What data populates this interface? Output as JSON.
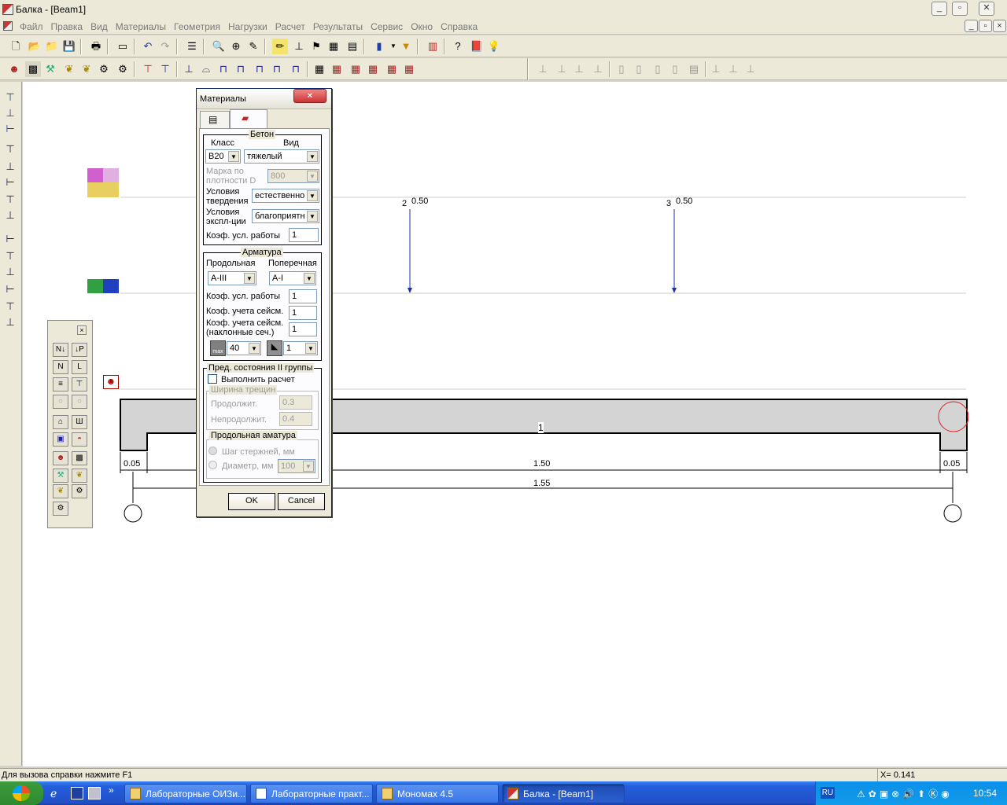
{
  "window": {
    "title": "Балка - [Beam1]"
  },
  "menu": [
    "Файл",
    "Правка",
    "Вид",
    "Материалы",
    "Геометрия",
    "Нагрузки",
    "Расчет",
    "Результаты",
    "Сервис",
    "Окно",
    "Справка"
  ],
  "dialog": {
    "title": "Материалы",
    "concrete": {
      "legend": "Бетон",
      "class_label": "Класс",
      "type_label": "Вид",
      "class_value": "В20",
      "type_value": "тяжелый",
      "density_label": "Марка по плотности D",
      "density_value": "800",
      "hardening_label": "Условия твердения",
      "hardening_value": "естественно",
      "operation_label": "Условия экспл-ции",
      "operation_value": "благоприятн",
      "work_coef_label": "Коэф. усл. работы",
      "work_coef_value": "1"
    },
    "rebar": {
      "legend": "Арматура",
      "long_label": "Продольная",
      "trans_label": "Поперечная",
      "long_value": "A-III",
      "trans_value": "A-I",
      "work_coef_label": "Коэф. усл. работы",
      "work_coef_value": "1",
      "seismic_label": "Коэф. учета сейсм.",
      "seismic_value": "1",
      "seismic_incl_label": "Коэф. учета сейсм. (наклонные сеч.)",
      "seismic_incl_value": "1",
      "max_diam_icon_text": "max",
      "max_diam_value": "40",
      "extra_value": "1"
    },
    "limit2": {
      "legend": "Пред. состояния II группы",
      "do_calc_label": "Выполнить расчет",
      "crack_legend": "Ширина трещин",
      "long_label": "Продолжит.",
      "long_value": "0.3",
      "short_label": "Непродолжит.",
      "short_value": "0.4",
      "long_rebar_legend": "Продольная аматура",
      "step_label": "Шаг стержней, мм",
      "diam_label": "Диаметр, мм",
      "diam_value": "100"
    },
    "ok": "OK",
    "cancel": "Cancel"
  },
  "drawing": {
    "loads": [
      {
        "node": "2",
        "value": "0.50"
      },
      {
        "node": "3",
        "value": "0.50"
      }
    ],
    "element_label": "1",
    "dim_left": "0.05",
    "dim_span": "1.50",
    "dim_right": "0.05",
    "dim_total": "1.55"
  },
  "status": {
    "hint": "Для вызова справки нажмите F1",
    "coord": "X= 0.141"
  },
  "taskbar": {
    "tasks": [
      "Лабораторные ОИЗи...",
      "Лабораторные практ...",
      "Мономах 4.5",
      "Балка - [Beam1]"
    ],
    "lang": "RU",
    "clock": "10:54"
  },
  "colors": {
    "beam_fill": "#d4d4d4",
    "load_arrow": "#2030a0",
    "selection": "#e02020"
  }
}
